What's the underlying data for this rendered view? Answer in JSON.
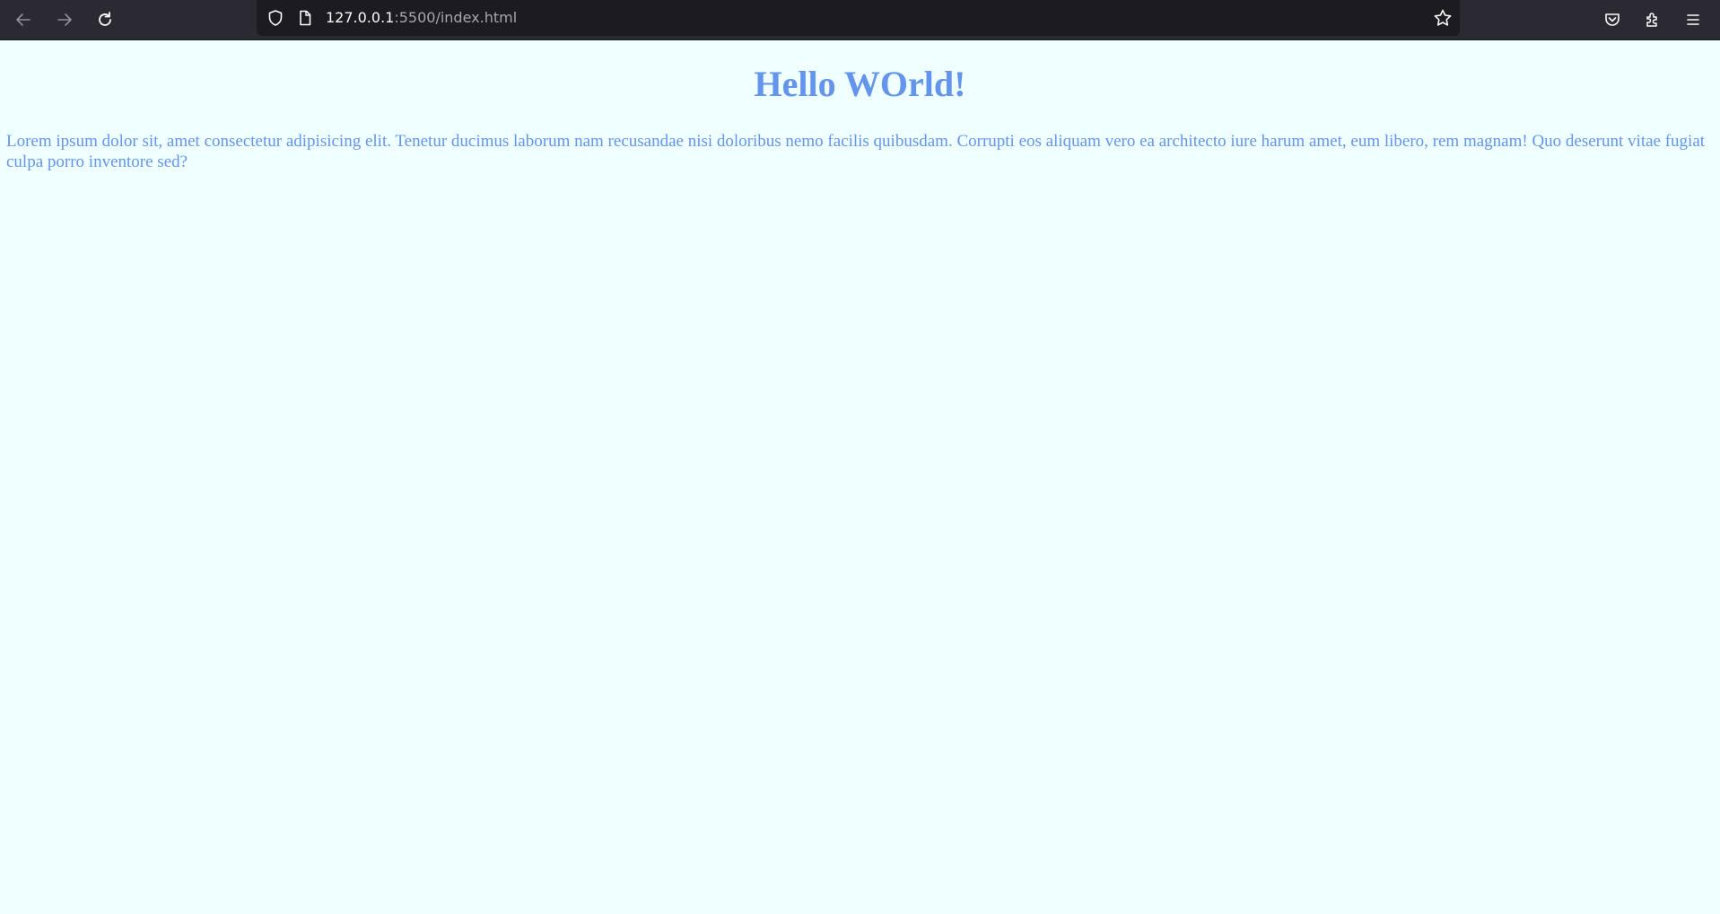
{
  "browser": {
    "url_host": "127.0.0.1",
    "url_rest": ":5500/index.html",
    "icons": {
      "back": "arrow-left-icon",
      "forward": "arrow-right-icon",
      "reload": "reload-icon",
      "shield": "shield-icon",
      "page": "page-icon",
      "bookmark": "star-icon",
      "pocket": "pocket-icon",
      "extensions": "puzzle-icon",
      "menu": "hamburger-menu-icon"
    },
    "colors": {
      "toolbar_bg": "#2b2a33",
      "urlbar_bg": "#1c1b22",
      "icon": "#fbfbfe",
      "icon_disabled": "#8f8f9d"
    }
  },
  "page": {
    "heading": "Hello WOrld!",
    "paragraph": "Lorem ipsum dolor sit, amet consectetur adipisicing elit. Tenetur ducimus laborum nam recusandae nisi doloribus nemo facilis quibusdam. Corrupti eos aliquam vero ea architecto iure harum amet, eum libero, rem magnam! Quo deserunt vitae fugiat culpa porro inventore sed?",
    "colors": {
      "background": "#f0ffff",
      "text": "#6495ed"
    }
  }
}
